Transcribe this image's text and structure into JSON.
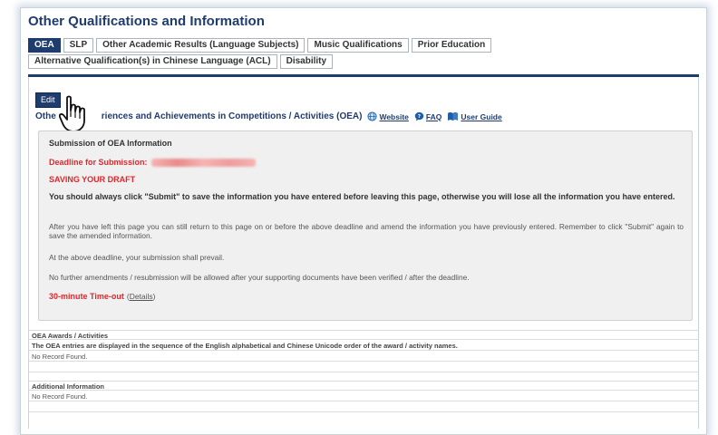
{
  "page": {
    "title": "Other Qualifications and Information"
  },
  "tabs": [
    {
      "label": "OEA",
      "active": true
    },
    {
      "label": "SLP",
      "active": false
    },
    {
      "label": "Other Academic Results (Language Subjects)",
      "active": false
    },
    {
      "label": "Music Qualifications",
      "active": false
    },
    {
      "label": "Prior Education",
      "active": false
    },
    {
      "label": "Alternative Qualification(s) in Chinese Language (ACL)",
      "active": false
    },
    {
      "label": "Disability",
      "active": false
    }
  ],
  "edit_button": {
    "label": "Edit"
  },
  "section": {
    "heading_start": "Othe",
    "heading_end": "riences and Achievements in Competitions / Activities (OEA)",
    "links": {
      "website": "Website",
      "faq": "FAQ",
      "user_guide": "User Guide"
    }
  },
  "notice": {
    "title": "Submission of OEA Information",
    "deadline_label": "Deadline for Submission:",
    "draft_heading": "SAVING YOUR DRAFT",
    "warning": "You should always click \"Submit\" to save the information you have entered before leaving this page, otherwise you will lose all the information you have entered.",
    "para1": "After you have left this page you can still return to this page on or before the above deadline and amend the information you have previously entered. Remember to click \"Submit\" again to save the amended information.",
    "para2": "At the above deadline, your submission shall prevail.",
    "para3": "No further amendments / resubmission will be allowed after your supporting documents have been verified / after the deadline.",
    "timeout_label": "30-minute Time-out",
    "details_open": "(",
    "details_link": "Details",
    "details_close": ")"
  },
  "awards": {
    "header": "OEA Awards / Activities",
    "note": "The OEA entries are displayed in the sequence of the English alphabetical and Chinese Unicode order of the award / activity names.",
    "empty": "No Record Found."
  },
  "additional": {
    "header": "Additional Information",
    "empty": "No Record Found."
  },
  "colors": {
    "brand": "#1f3c6e",
    "alert": "#e0262b"
  }
}
